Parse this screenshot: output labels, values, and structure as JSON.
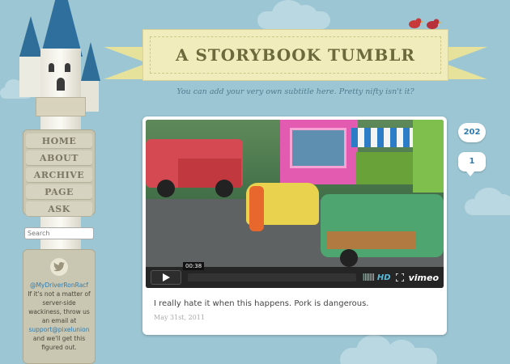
{
  "header": {
    "title": "A STORYBOOK TUMBLR",
    "subtitle": "You can add your very own subtitle here. Pretty nifty isn't it?"
  },
  "nav": {
    "items": [
      {
        "label": "HOME"
      },
      {
        "label": "ABOUT"
      },
      {
        "label": "ARCHIVE"
      },
      {
        "label": "PAGE"
      },
      {
        "label": "ASK"
      }
    ]
  },
  "search": {
    "placeholder": "Search"
  },
  "twitter": {
    "handle": "@MyDriverRonRacf",
    "lines": [
      "If it's not a matter of",
      "server-side",
      "wackiness, throw us",
      "an email at"
    ],
    "email": "support@pixelunion",
    "closing": [
      "and we'll get this",
      "figured out."
    ]
  },
  "post": {
    "video": {
      "time": "00:38",
      "hd_label": "HD",
      "brand": "vimeo"
    },
    "caption": "I really hate it when this happens. Pork is dangerous.",
    "date": "May 31st, 2011"
  },
  "counters": {
    "notes": "202",
    "reblogs": "1"
  },
  "colors": {
    "background": "#9cc6d3",
    "banner": "#f1ecbc",
    "title": "#6c6a3c",
    "link": "#2f7db0"
  }
}
